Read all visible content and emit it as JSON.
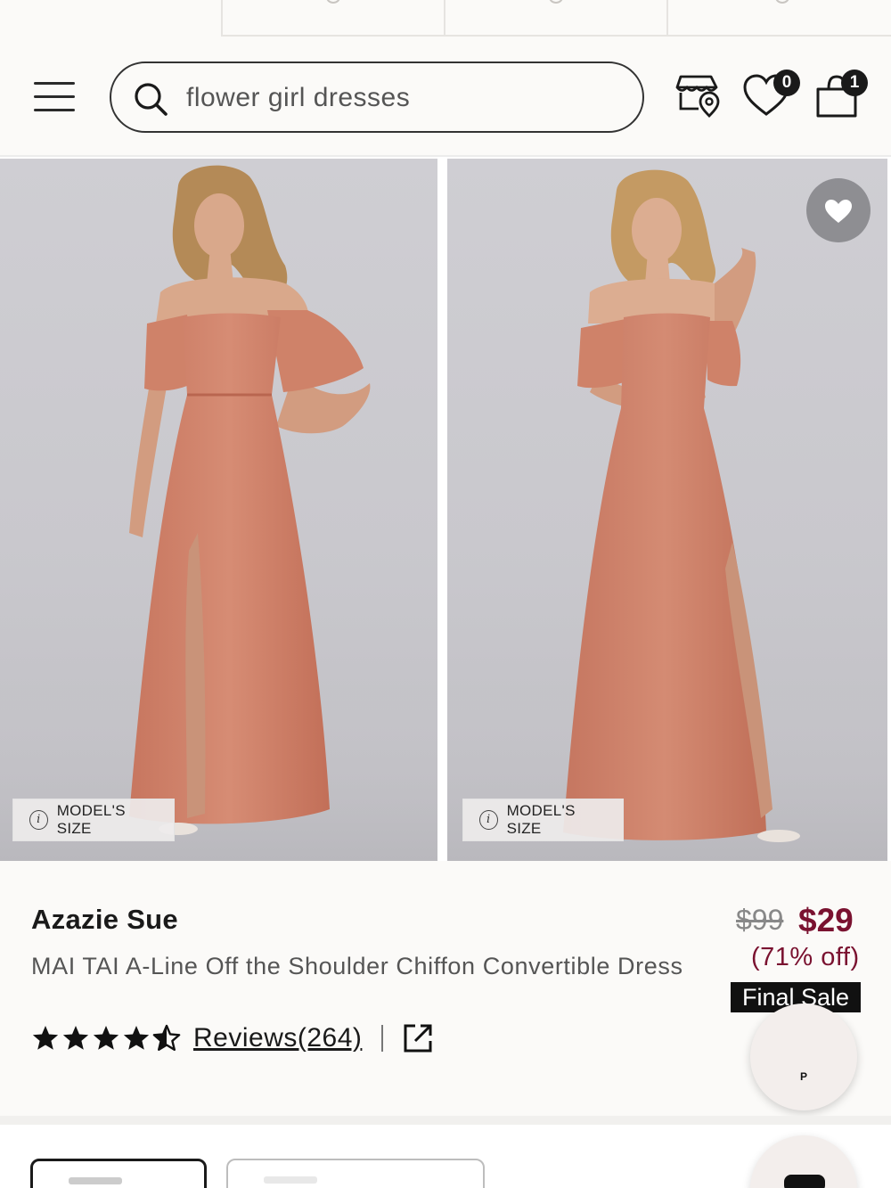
{
  "header": {
    "search_value": "flower girl dresses",
    "wishlist_count": "0",
    "bag_count": "1"
  },
  "gallery": {
    "model_size_label_1": "MODEL'S SIZE",
    "model_size_label_2": "MODEL'S SIZE",
    "info_glyph": "i"
  },
  "product": {
    "brand": "Azazie Sue",
    "name": "MAI TAI A-Line Off the Shoulder Chiffon Convertible Dress",
    "rating": 4.5,
    "reviews_label": "Reviews(264)",
    "price_original": "$99",
    "price_sale": "$29",
    "discount": "(71% off)",
    "final_sale": "Final Sale"
  },
  "chat_bubble": {
    "label": "P"
  },
  "colors": {
    "accent_price": "#7a1230",
    "dress": "#d18871",
    "background": "#fbfaf8"
  },
  "icons": [
    "hamburger-menu-icon",
    "search-icon",
    "store-locator-icon",
    "heart-icon",
    "shopping-bag-icon",
    "star-icon",
    "external-link-icon",
    "info-icon"
  ]
}
